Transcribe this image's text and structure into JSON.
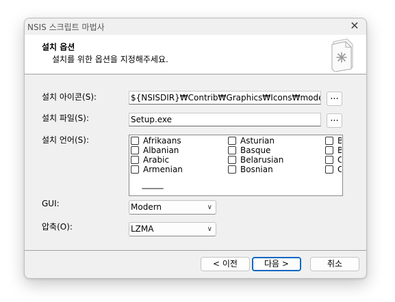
{
  "window": {
    "title": "NSIS 스크립트 마법사",
    "close_label": "✕"
  },
  "header": {
    "title": "설치 옵션",
    "subtitle": "설치를 위한 옵션을 지정해주세요."
  },
  "form": {
    "icon": {
      "label": "설치 아이콘(S):",
      "value": "${NSISDIR}₩Contrib₩Graphics₩Icons₩modern",
      "browse": "..."
    },
    "file": {
      "label": "설치 파일(S):",
      "value": "Setup.exe",
      "browse": "..."
    },
    "languages": {
      "label": "설치 언어(S):",
      "items": [
        [
          "Afrikaans",
          "Asturian",
          "B"
        ],
        [
          "Albanian",
          "Basque",
          "B"
        ],
        [
          "Arabic",
          "Belarusian",
          "C"
        ],
        [
          "Armenian",
          "Bosnian",
          "C"
        ]
      ]
    },
    "gui": {
      "label": "GUI:",
      "value": "Modern"
    },
    "compression": {
      "label": "압축(O):",
      "value": "LZMA"
    }
  },
  "buttons": {
    "back": "< 이전",
    "next": "다음 >",
    "cancel": "취소"
  },
  "icons": {
    "header": "setup-document-icon",
    "chevron": "chevron-down-icon"
  }
}
